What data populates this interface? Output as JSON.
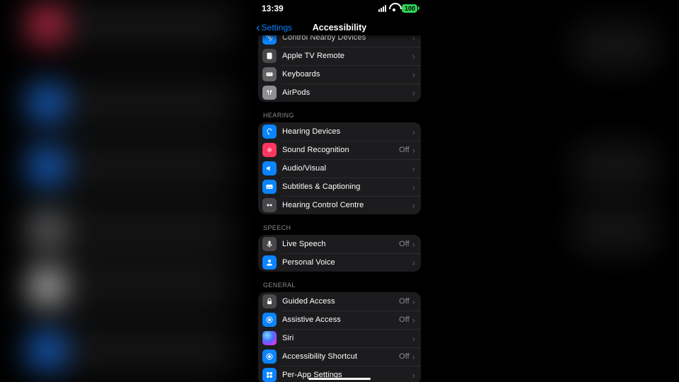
{
  "status": {
    "time": "13:39",
    "battery": "100"
  },
  "nav": {
    "back": "Settings",
    "title": "Accessibility"
  },
  "physical_tail": {
    "items": [
      {
        "icon": "control-nearby-icon",
        "bg": "bg-blue",
        "label": "Control Nearby Devices"
      },
      {
        "icon": "apple-tv-icon",
        "bg": "bg-dgrey",
        "label": "Apple TV Remote"
      },
      {
        "icon": "keyboard-icon",
        "bg": "bg-grey",
        "label": "Keyboards"
      },
      {
        "icon": "airpods-icon",
        "bg": "bg-ltgrey",
        "label": "AirPods"
      }
    ]
  },
  "sections": {
    "hearing": {
      "title": "HEARING",
      "items": [
        {
          "icon": "ear-icon",
          "bg": "bg-blue",
          "label": "Hearing Devices",
          "value": ""
        },
        {
          "icon": "waveform-icon",
          "bg": "bg-red",
          "label": "Sound Recognition",
          "value": "Off"
        },
        {
          "icon": "speaker-icon",
          "bg": "bg-blue",
          "label": "Audio/Visual",
          "value": ""
        },
        {
          "icon": "captions-icon",
          "bg": "bg-blue",
          "label": "Subtitles & Captioning",
          "value": ""
        },
        {
          "icon": "hearing-cc-icon",
          "bg": "bg-dgrey",
          "label": "Hearing Control Centre",
          "value": ""
        }
      ]
    },
    "speech": {
      "title": "SPEECH",
      "items": [
        {
          "icon": "mic-icon",
          "bg": "bg-dgrey",
          "label": "Live Speech",
          "value": "Off"
        },
        {
          "icon": "person-icon",
          "bg": "bg-blue",
          "label": "Personal Voice",
          "value": ""
        }
      ]
    },
    "general": {
      "title": "GENERAL",
      "items": [
        {
          "icon": "lock-icon",
          "bg": "bg-dgrey",
          "label": "Guided Access",
          "value": "Off"
        },
        {
          "icon": "assistive-icon",
          "bg": "bg-blue",
          "label": "Assistive Access",
          "value": "Off"
        },
        {
          "icon": "siri-icon",
          "bg": "bg-siri",
          "label": "Siri",
          "value": ""
        },
        {
          "icon": "shortcut-icon",
          "bg": "bg-blue",
          "label": "Accessibility Shortcut",
          "value": "Off"
        },
        {
          "icon": "perapp-icon",
          "bg": "bg-blue",
          "label": "Per-App Settings",
          "value": ""
        }
      ]
    }
  }
}
